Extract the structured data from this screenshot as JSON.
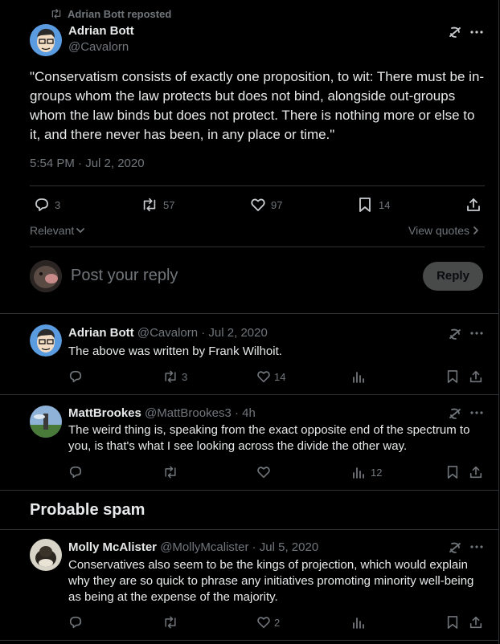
{
  "repost": {
    "label": "Adrian Bott reposted"
  },
  "main_post": {
    "author": "Adrian Bott",
    "handle": "@Cavalorn",
    "text": "\"Conservatism consists of exactly one proposition, to wit: There must be in-groups whom the law protects but does not bind, alongside out-groups whom the law binds but does not protect. There is nothing more or else to it, and there never has been, in any place or time.\"",
    "timestamp": "5:54 PM · Jul 2, 2020",
    "stats": {
      "replies": "3",
      "reposts": "57",
      "likes": "97",
      "bookmarks": "14"
    }
  },
  "sort": {
    "label": "Relevant",
    "view_quotes": "View quotes"
  },
  "composer": {
    "placeholder": "Post your reply",
    "button": "Reply"
  },
  "replies": [
    {
      "author": "Adrian Bott",
      "meta": "@Cavalorn · Jul 2, 2020",
      "text": "The above was written by Frank Wilhoit.",
      "replies": "",
      "reposts": "3",
      "likes": "14",
      "views": ""
    },
    {
      "author": "MattBrookes",
      "meta": "@MattBrookes3 · 4h",
      "text": "The weird thing is, speaking from the exact opposite end of the spectrum to you, is that's what I see looking across the divide the other way.",
      "replies": "",
      "reposts": "",
      "likes": "",
      "views": "12"
    }
  ],
  "spam_section": {
    "heading": "Probable spam",
    "reply": {
      "author": "Molly McAlister",
      "meta": "@MollyMcalister · Jul 5, 2020",
      "text": "Conservatives also seem to be the kings of projection, which would explain why they are so quick to phrase any initiatives promoting minority well-being as being at the expense of the majority.",
      "replies": "",
      "reposts": "",
      "likes": "2",
      "views": ""
    }
  },
  "icons": [
    "repost-icon",
    "grok-icon",
    "more-icon",
    "reply-icon",
    "like-icon",
    "bookmark-icon",
    "share-icon",
    "views-icon",
    "chevron-down-icon",
    "chevron-right-icon"
  ],
  "colors": {
    "background": "#000000",
    "text": "#e7e9ea",
    "muted": "#71767b",
    "border": "#2f3336"
  }
}
